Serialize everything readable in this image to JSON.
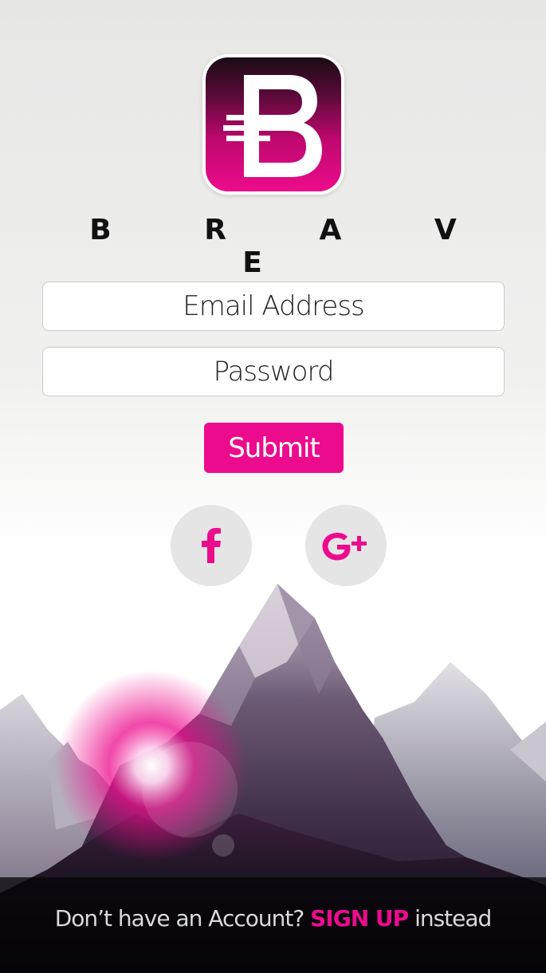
{
  "app": {
    "brand_name": "B R A V E",
    "logo_letter": "B"
  },
  "form": {
    "email_placeholder": "Email Address",
    "password_placeholder": "Password",
    "submit_label": "Submit"
  },
  "social": [
    {
      "name": "facebook",
      "icon": "facebook-icon"
    },
    {
      "name": "google-plus",
      "icon": "google-plus-icon"
    }
  ],
  "footer": {
    "prompt": "Don’t have an Account?",
    "signup_label": "SIGN UP",
    "suffix": "instead"
  },
  "colors": {
    "accent": "#ec0b8c",
    "text_dark": "#111111",
    "social_bg": "#e5e5e6",
    "footer_text": "#d9d9de"
  }
}
